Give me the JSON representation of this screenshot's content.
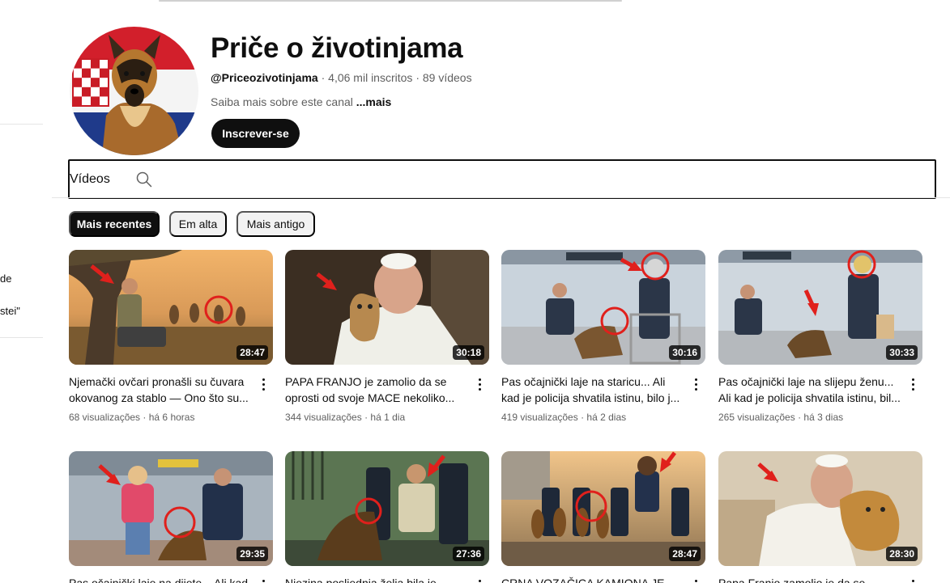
{
  "channel": {
    "name": "Priče o životinjama",
    "handle": "@Priceozivotinjama",
    "separator": "·",
    "subscribers": "4,06 mil inscritos",
    "video_count": "89 vídeos",
    "about": "Saiba mais sobre este canal",
    "about_more": "...mais",
    "subscribe_label": "Inscrever-se"
  },
  "sidebar_fragments": [
    "de",
    "stei\""
  ],
  "tabs": {
    "videos": "Vídeos"
  },
  "chips": [
    {
      "label": "Mais recentes",
      "active": true
    },
    {
      "label": "Em alta",
      "active": false
    },
    {
      "label": "Mais antigo",
      "active": false
    }
  ],
  "videos": [
    {
      "title": "Njemački ovčari pronašli su čuvara okovanog za stablo — Ono što su...",
      "views": "68 visualizações",
      "age": "há 6 horas",
      "duration": "28:47"
    },
    {
      "title": "PAPA FRANJO je zamolio da se oprosti od svoje MACE nekoliko...",
      "views": "344 visualizações",
      "age": "há 1 dia",
      "duration": "30:18"
    },
    {
      "title": "Pas očajnički laje na staricu... Ali kad je policija shvatila istinu, bilo j...",
      "views": "419 visualizações",
      "age": "há 2 dias",
      "duration": "30:16"
    },
    {
      "title": "Pas očajnički laje na slijepu ženu... Ali kad je policija shvatila istinu, bil...",
      "views": "265 visualizações",
      "age": "há 3 dias",
      "duration": "30:33"
    },
    {
      "title": "Pas očajnički laje na dijete... Ali kad",
      "views": "",
      "age": "",
      "duration": "29:35"
    },
    {
      "title": "Njezina posljednja želja bila je",
      "views": "",
      "age": "",
      "duration": "27:36"
    },
    {
      "title": "CRNA VOZAČICA KAMIONA JE",
      "views": "",
      "age": "",
      "duration": "28:47"
    },
    {
      "title": "Papa Franjo zamolio je da se oprosti",
      "views": "",
      "age": "",
      "duration": "28:30"
    }
  ],
  "colors": {
    "accent_dark": "#0f0f0f",
    "chip_bg": "#f2f2f2",
    "meta_gray": "#606060",
    "highlight_red": "#e0201c"
  }
}
